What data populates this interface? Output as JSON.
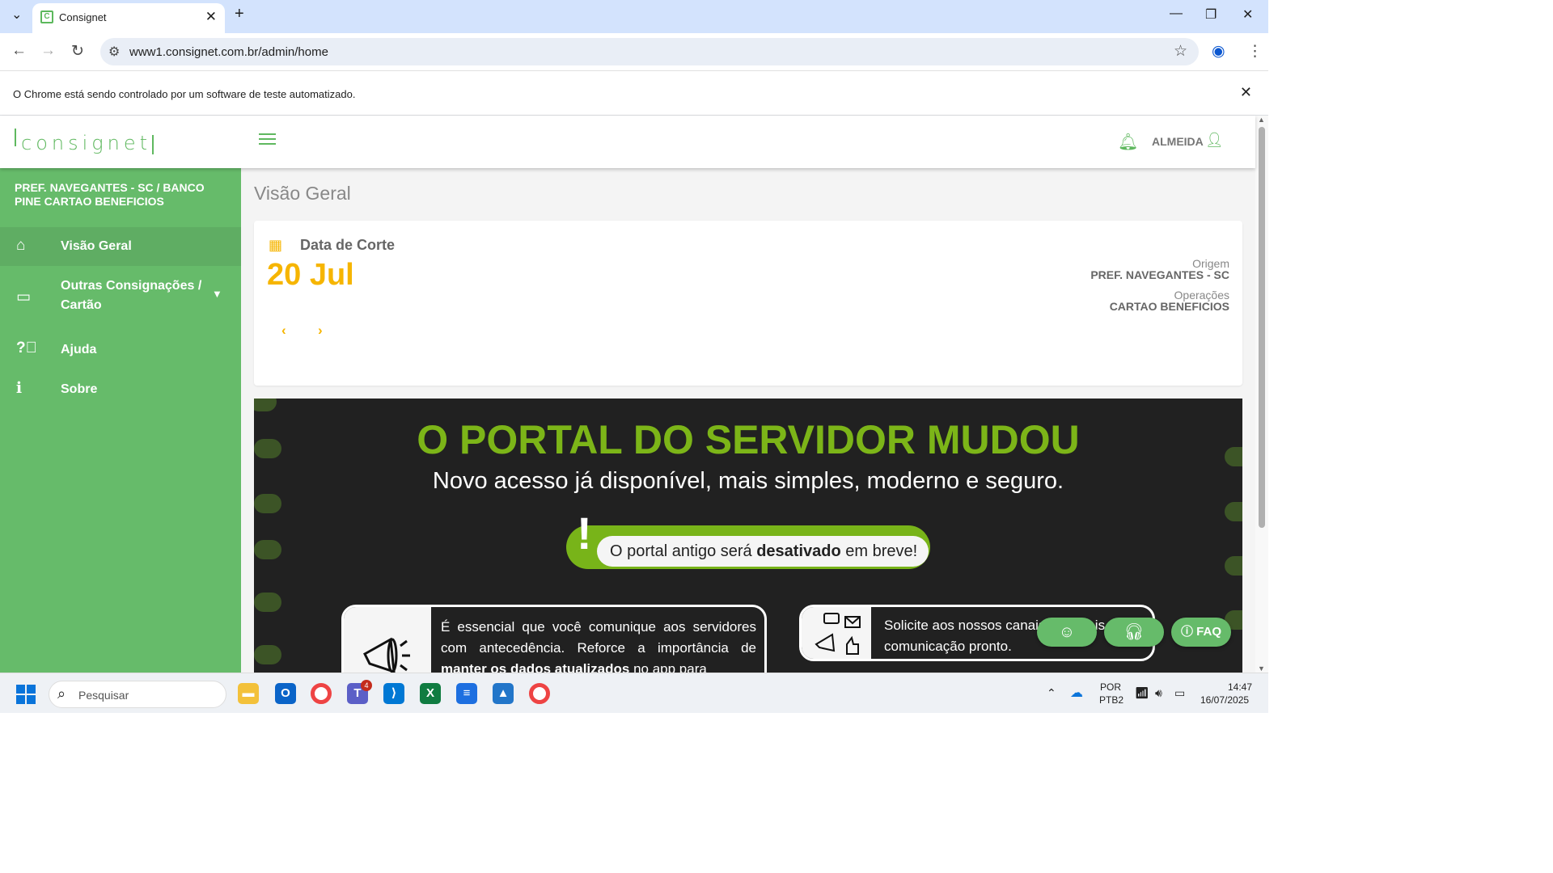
{
  "browser": {
    "tab_title": "Consignet",
    "tab_favicon": "C",
    "url": "www1.consignet.com.br/admin/home",
    "automation_notice": "O Chrome está sendo controlado por um software de teste automatizado."
  },
  "header": {
    "logo_text": "consignet",
    "user_name": "ALMEIDA"
  },
  "sidebar": {
    "org_name": "PREF. NAVEGANTES - SC / BANCO PINE CARTAO BENEFICIOS",
    "items": [
      {
        "label": "Visão Geral",
        "icon": "home-icon",
        "active": true
      },
      {
        "label": "Outras Consignações / Cartão",
        "icon": "credit-card-icon"
      },
      {
        "label": "Ajuda",
        "icon": "help-circle-icon"
      },
      {
        "label": "Sobre",
        "icon": "info-icon"
      }
    ]
  },
  "main": {
    "page_title": "Visão Geral",
    "corte_label": "Data de Corte",
    "corte_date": "20 Jul",
    "origem_label": "Origem",
    "origem_value": "PREF. NAVEGANTES - SC",
    "operacoes_label": "Operações",
    "operacoes_value": "CARTAO BENEFICIOS"
  },
  "banner": {
    "title": "O PORTAL DO SERVIDOR MUDOU",
    "subtitle": "Novo acesso já disponível, mais simples, moderno e seguro.",
    "pill_pre": "O portal antigo será ",
    "pill_bold": "desativado",
    "pill_post": " em breve!",
    "box1_pre": "É essencial que você comunique aos servidores com antecedência. Reforce a importância de ",
    "box1_bold": "manter os dados atualizados",
    "box1_post": " no app para",
    "box2_text": "Solicite aos nossos canais materiais de comunicação pronto."
  },
  "fabs": {
    "faq_label": "FAQ"
  },
  "taskbar": {
    "search_placeholder": "Pesquisar",
    "teams_badge": "4",
    "lang_line1": "POR",
    "lang_line2": "PTB2",
    "time": "14:47",
    "date": "16/07/2025"
  },
  "colors": {
    "accent_green": "#66bb6a",
    "banner_green": "#7cb518",
    "date_yellow": "#f6b500"
  }
}
